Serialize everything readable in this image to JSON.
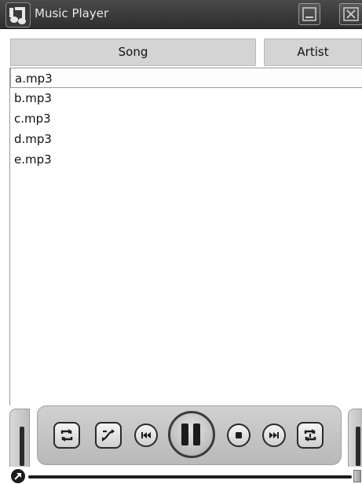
{
  "window": {
    "title": "Music Player",
    "icon": "music-note-icon",
    "buttons": [
      "minimize-icon",
      "close-icon"
    ]
  },
  "columns": {
    "song": "Song",
    "artist": "Artist"
  },
  "files": [
    "a.mp3",
    "b.mp3",
    "c.mp3",
    "d.mp3",
    "e.mp3"
  ],
  "selected_index": 0,
  "controls": {
    "buttons": [
      "repeat-icon",
      "shuffle-icon",
      "previous-icon",
      "pause-icon",
      "stop-icon",
      "next-icon",
      "repeat-one-icon"
    ]
  },
  "progress": {
    "fraction": 0.0
  },
  "colors": {
    "titlebar": "#3a3a3a",
    "header": "#d4d4d4",
    "controls": "#c4c4c4"
  }
}
